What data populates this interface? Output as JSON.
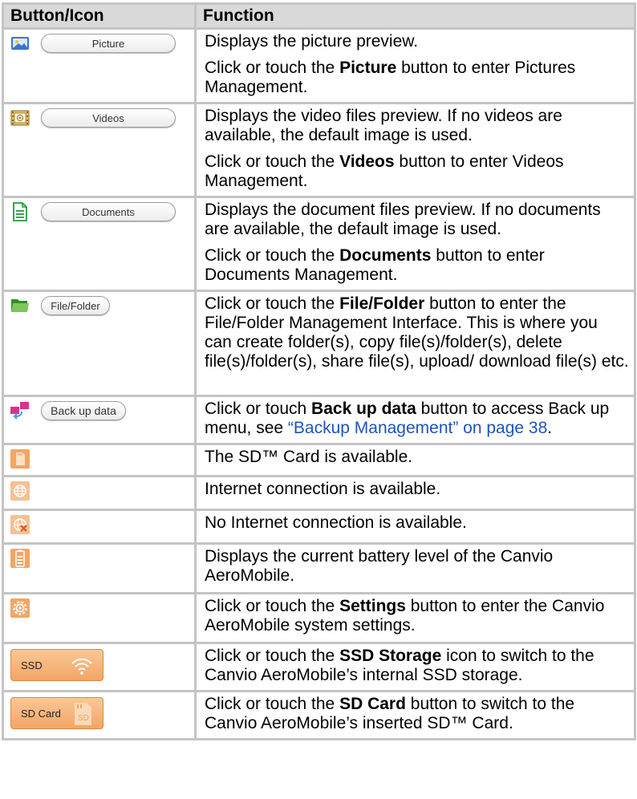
{
  "table": {
    "header": {
      "col1": "Button/Icon",
      "col2": "Function"
    },
    "rows": [
      {
        "icon": "picture-icon",
        "button": "Picture",
        "p1": "Displays the picture preview.",
        "p2a": "Click or touch the ",
        "p2b": "Picture",
        "p2c": " button to enter Pictures Management."
      },
      {
        "icon": "video-icon",
        "button": "Videos",
        "p1": "Displays the video files preview. If no videos are available, the default image is used.",
        "p2a": "Click or touch the ",
        "p2b": "Videos",
        "p2c": " button to enter Videos Management."
      },
      {
        "icon": "document-icon",
        "button": "Documents",
        "p1": "Displays the document files preview. If no documents are available, the default image is used.",
        "p2a": "Click or touch the ",
        "p2b": "Documents",
        "p2c": " button to enter Documents Management."
      },
      {
        "icon": "folder-icon",
        "button": "File/Folder",
        "p1a": "Click or touch the ",
        "p1b": "File/Folder",
        "p1c": " button to enter the File/Folder Management Interface. This is where you can create folder(s), copy file(s)/folder(s), delete file(s)/folder(s), share file(s), upload/ download file(s) etc."
      },
      {
        "icon": "backup-icon",
        "button": "Back up data",
        "p1a": "Click or touch ",
        "p1b": "Back up data",
        "p1c": " button to access Back up menu, see ",
        "link": "“Backup Management” on page 38",
        "p1d": "."
      },
      {
        "icon": "sd-card-icon",
        "p1": "The SD™ Card is available."
      },
      {
        "icon": "internet-icon",
        "p1": "Internet connection is available."
      },
      {
        "icon": "no-internet-icon",
        "p1": "No Internet connection is available."
      },
      {
        "icon": "battery-icon",
        "p1": "Displays the current battery level of the Canvio AeroMobile."
      },
      {
        "icon": "settings-icon",
        "p1a": "Click or touch the ",
        "p1b": "Settings",
        "p1c": " button to enter the Canvio AeroMobile system settings."
      },
      {
        "button": "SSD",
        "p1a": "Click or touch the ",
        "p1b": "SSD Storage",
        "p1c": " icon to switch to the Canvio AeroMobile’s internal SSD storage."
      },
      {
        "button": "SD Card",
        "p1a": "Click or touch the ",
        "p1b": "SD Card",
        "p1c": " button to switch to the Canvio AeroMobile’s inserted SD™ Card."
      }
    ]
  },
  "colors": {
    "header_bg": "#d9d9d9",
    "border": "#c4c4c4",
    "link": "#1f55b8",
    "accent_orange": "#f3a565"
  }
}
